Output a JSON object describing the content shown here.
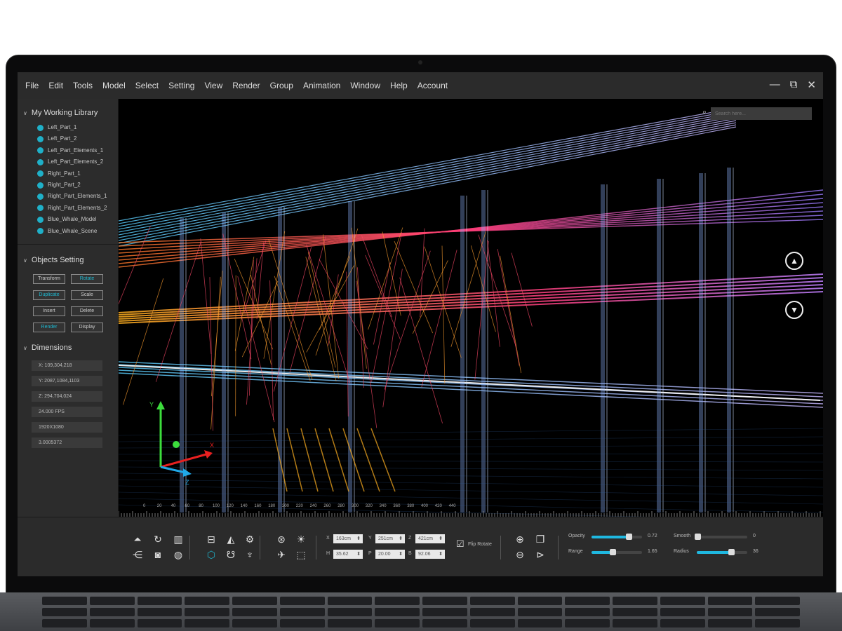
{
  "menu": [
    "File",
    "Edit",
    "Tools",
    "Model",
    "Select",
    "Setting",
    "View",
    "Render",
    "Group",
    "Animation",
    "Window",
    "Help",
    "Account"
  ],
  "window_controls": {
    "minimize": "—",
    "restore": "⧉",
    "close": "✕"
  },
  "library": {
    "title": "My Working Library",
    "items": [
      "Left_Part_1",
      "Left_Part_2",
      "Left_Part_Elements_1",
      "Left_Part_Elements_2",
      "Right_Part_1",
      "Right_Part_2",
      "Right_Part_Elements_1",
      "Right_Part_Elements_2",
      "Blue_Whale_Model",
      "Blue_Whale_Scene"
    ]
  },
  "objects_setting": {
    "title": "Objects Setting",
    "buttons": [
      {
        "label": "Transform",
        "active": false
      },
      {
        "label": "Rotate",
        "active": true
      },
      {
        "label": "Duplicate",
        "active": true
      },
      {
        "label": "Scale",
        "active": false
      },
      {
        "label": "Insert",
        "active": false
      },
      {
        "label": "Delete",
        "active": false
      },
      {
        "label": "Render",
        "active": true
      },
      {
        "label": "Display",
        "active": false
      }
    ]
  },
  "dimensions": {
    "title": "Dimensions",
    "values": [
      "X: 109,304,218",
      "Y: 2087,1084,1103",
      "Z: 294,704,024",
      "24.000 FPS",
      "1920X1080",
      "3.0005372"
    ]
  },
  "search": {
    "placeholder": "Search here..."
  },
  "axes": {
    "x": "X",
    "y": "Y",
    "z": "Z"
  },
  "ruler": [
    "0",
    "20",
    "40",
    "60",
    "80",
    "100",
    "120",
    "140",
    "160",
    "180",
    "200",
    "220",
    "240",
    "260",
    "280",
    "300",
    "320",
    "340",
    "360",
    "380",
    "400",
    "420",
    "440"
  ],
  "toolbar": {
    "coords": [
      {
        "label": "X",
        "value": "163cm"
      },
      {
        "label": "Y",
        "value": "251cm"
      },
      {
        "label": "Z",
        "value": "421cm"
      },
      {
        "label": "H",
        "value": "35.62"
      },
      {
        "label": "P",
        "value": "20.00"
      },
      {
        "label": "B",
        "value": "92.06"
      }
    ],
    "flip_rotate": {
      "label": "Flip Rotate",
      "checked": true
    },
    "sliders": [
      {
        "label": "Opacity",
        "value": "0.72",
        "fraction": 0.74
      },
      {
        "label": "Smooth",
        "value": "0",
        "fraction": 0.02
      },
      {
        "label": "Range",
        "value": "1.65",
        "fraction": 0.42
      },
      {
        "label": "Radius",
        "value": "36",
        "fraction": 0.68
      }
    ]
  },
  "accent": "#1fb8e0"
}
